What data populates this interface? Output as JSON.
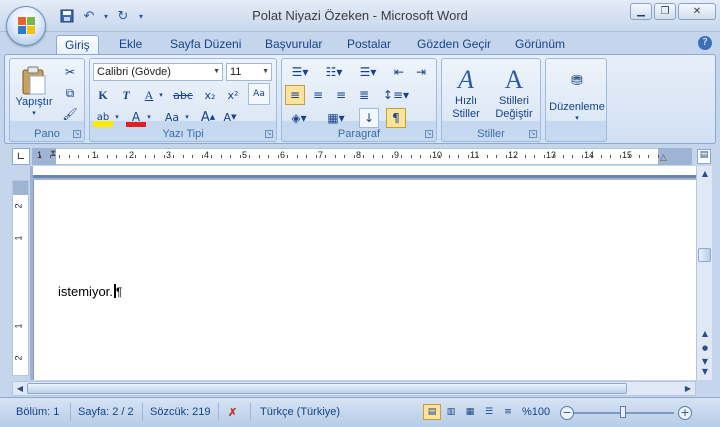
{
  "window": {
    "title": "Polat Niyazi Özeken - Microsoft Word"
  },
  "ribbon": {
    "tabs": [
      "Giriş",
      "Ekle",
      "Sayfa Düzeni",
      "Başvurular",
      "Postalar",
      "Gözden Geçir",
      "Görünüm"
    ],
    "active_tab": "Giriş",
    "groups": {
      "pano": {
        "label": "Pano",
        "paste_label": "Yapıştır"
      },
      "font": {
        "label": "Yazı Tipi",
        "font_name": "Calibri (Gövde)",
        "font_size": "11"
      },
      "paragraph": {
        "label": "Paragraf"
      },
      "styles": {
        "label": "Stiller",
        "quick_styles": "Hızlı Stiller",
        "change_styles": "Stilleri Değiştir"
      },
      "editing": {
        "label": "Düzenleme"
      }
    }
  },
  "ruler": {
    "numbers": [
      "1",
      "1",
      "2",
      "3",
      "4",
      "5",
      "6",
      "7",
      "8",
      "9",
      "10",
      "11",
      "12",
      "13",
      "14",
      "15"
    ]
  },
  "vruler": {
    "numbers": [
      "2",
      "1",
      "1",
      "2"
    ]
  },
  "document": {
    "text": "istemiyor."
  },
  "statusbar": {
    "section": "Bölüm: 1",
    "page": "Sayfa: 2 / 2",
    "words": "Sözcük: 219",
    "language": "Türkçe (Türkiye)",
    "zoom": "%100"
  },
  "colors": {
    "accent": "#15428b",
    "ribbon_bg": "#dde8f6",
    "active_view": "#fbe39c"
  }
}
